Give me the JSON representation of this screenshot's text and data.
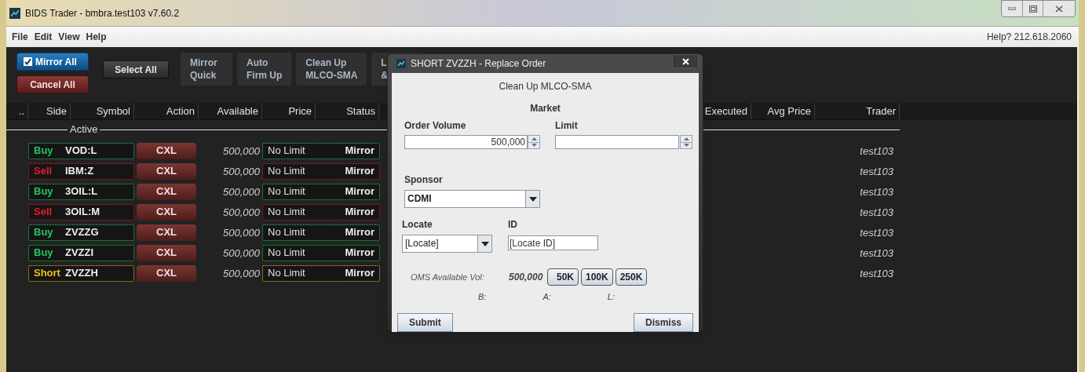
{
  "window": {
    "title": "BIDS Trader - bmbra.test103 v7.60.2",
    "menu": [
      "File",
      "Edit",
      "View",
      "Help"
    ],
    "help_text": "Help? 212.618.2060"
  },
  "toolbar": {
    "buttons": [
      {
        "kind": "checkbox",
        "lines": [
          "Mirror All"
        ],
        "checked": true
      },
      {
        "kind": "danger",
        "lines": [
          "Cancel All"
        ]
      },
      {
        "kind": "raised",
        "lines": [
          "Select All"
        ]
      },
      {
        "kind": "flat",
        "lines": [
          "Mirror",
          "Quick"
        ]
      },
      {
        "kind": "flat",
        "lines": [
          "Auto",
          "Firm Up"
        ]
      },
      {
        "kind": "flat",
        "lines": [
          "Clean Up",
          "MLCO-SMA"
        ]
      },
      {
        "kind": "flat",
        "lines": [
          "L",
          "&"
        ]
      }
    ]
  },
  "table": {
    "columns": [
      "..",
      "Side",
      "Symbol",
      "Action",
      "Available",
      "Price",
      "Status",
      "Executed",
      "Avg Price",
      "Trader"
    ],
    "group": "Active",
    "rows": [
      {
        "side": "Buy",
        "color": "#22c55e",
        "symbol": "VOD:L",
        "action": "CXL",
        "available": "500,000",
        "price": "No Limit",
        "status": "Mirror",
        "trader": "test103"
      },
      {
        "side": "Sell",
        "color": "#e11d2a",
        "symbol": "IBM:Z",
        "action": "CXL",
        "available": "500,000",
        "price": "No Limit",
        "status": "Mirror",
        "trader": "test103"
      },
      {
        "side": "Buy",
        "color": "#22c55e",
        "symbol": "3OIL:L",
        "action": "CXL",
        "available": "500,000",
        "price": "No Limit",
        "status": "Mirror",
        "trader": "test103"
      },
      {
        "side": "Sell",
        "color": "#e11d2a",
        "symbol": "3OIL:M",
        "action": "CXL",
        "available": "500,000",
        "price": "No Limit",
        "status": "Mirror",
        "trader": "test103"
      },
      {
        "side": "Buy",
        "color": "#22c55e",
        "symbol": "ZVZZG",
        "action": "CXL",
        "available": "500,000",
        "price": "No Limit",
        "status": "Mirror",
        "trader": "test103"
      },
      {
        "side": "Buy",
        "color": "#22c55e",
        "symbol": "ZVZZI",
        "action": "CXL",
        "available": "500,000",
        "price": "No Limit",
        "status": "Mirror",
        "trader": "test103"
      },
      {
        "side": "Short",
        "color": "#e8c21a",
        "symbol": "ZVZZH",
        "action": "CXL",
        "available": "500,000",
        "price": "No Limit",
        "status": "Mirror",
        "trader": "test103"
      }
    ]
  },
  "dialog": {
    "title": "SHORT ZVZZH - Replace Order",
    "subtitle": "Clean Up MLCO-SMA",
    "order_type": "Market",
    "order_volume": {
      "label": "Order Volume",
      "value": "500,000"
    },
    "limit": {
      "label": "Limit"
    },
    "sponsor": {
      "label": "Sponsor",
      "value": "CDMI"
    },
    "locate": {
      "label": "Locate",
      "value": "[Locate]"
    },
    "locate_id": {
      "label": "ID",
      "value": "[Locate ID]"
    },
    "oms_label": "OMS Available Vol:",
    "oms_value": "500,000",
    "quick_volumes": [
      "50K",
      "100K",
      "250K"
    ],
    "bal": [
      "B:",
      "A:",
      "L:"
    ],
    "buttons": [
      "Submit",
      "Dismiss"
    ]
  }
}
